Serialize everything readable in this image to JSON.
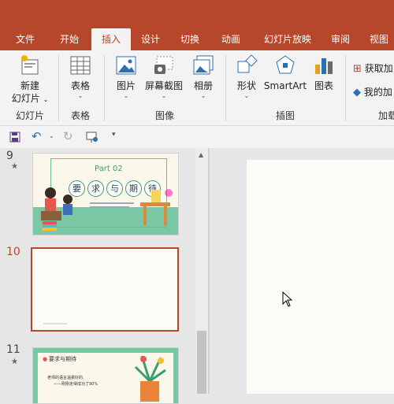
{
  "menu": {
    "tabs": [
      "文件",
      "开始",
      "插入",
      "设计",
      "切换",
      "动画",
      "幻灯片放映",
      "审阅",
      "视图"
    ],
    "active": "插入"
  },
  "ribbon": {
    "new_slide": {
      "line1": "新建",
      "line2": "幻灯片"
    },
    "table": "表格",
    "picture": "图片",
    "screenshot": "屏幕截图",
    "album": "相册",
    "shapes": "形状",
    "smartart": "SmartArt",
    "chart": "图表",
    "get_addins": "获取加",
    "my_addins": "我的加",
    "groups": {
      "slides": "幻灯片",
      "tables": "表格",
      "images": "图像",
      "illustrations": "插图",
      "addins": "加载"
    }
  },
  "thumbnails": [
    {
      "number": "9",
      "part": "Part 02",
      "title_chars": [
        "要",
        "求",
        "与",
        "期",
        "待"
      ]
    },
    {
      "number": "10"
    },
    {
      "number": "11",
      "heading": "要求与期待",
      "line1": "老师的语言温柔好的,",
      "line2": "——刚刚走得成功了90%"
    }
  ],
  "colors": {
    "accent": "#b7472a",
    "slide_green": "#7ac7a6",
    "canvas": "#fdfbf5"
  }
}
